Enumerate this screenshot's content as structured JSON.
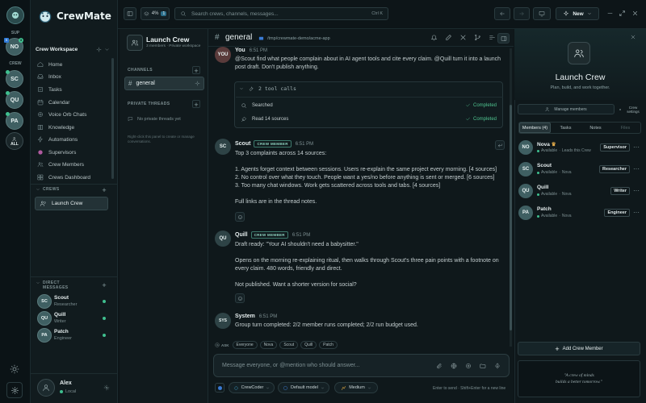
{
  "rail": {
    "sup_label": "SUP",
    "sup_avatar": "NO",
    "sup_badge": "5",
    "crew_label": "CREW",
    "crew_avatars": [
      "SC",
      "QU",
      "PA"
    ],
    "all_label": "ALL",
    "badge_a": "S",
    "badge_b": "3"
  },
  "brand": {
    "name": "CrewMate"
  },
  "sidebar": {
    "workspace": "Crew Workspace",
    "nav": [
      {
        "label": "Home",
        "icon": "home-icon"
      },
      {
        "label": "Inbox",
        "icon": "inbox-icon"
      },
      {
        "label": "Tasks",
        "icon": "tasks-icon"
      },
      {
        "label": "Calendar",
        "icon": "calendar-icon"
      },
      {
        "label": "Voice Orb Chats",
        "icon": "voice-icon"
      },
      {
        "label": "Knowledge",
        "icon": "book-icon"
      },
      {
        "label": "Automations",
        "icon": "automation-icon"
      },
      {
        "label": "Supervisors",
        "icon": "supervisor-icon"
      },
      {
        "label": "Crew Members",
        "icon": "members-icon"
      },
      {
        "label": "Crews Dashboard",
        "icon": "dashboard-icon"
      }
    ],
    "crews_header": "CREWS",
    "crew_item": "Launch Crew",
    "dm_header": "DIRECT MESSAGES",
    "dms": [
      {
        "name": "Scout",
        "role": "Researcher",
        "avatar": "SC"
      },
      {
        "name": "Quill",
        "role": "Writer",
        "avatar": "QU"
      },
      {
        "name": "Patch",
        "role": "Engineer",
        "avatar": "PA"
      }
    ],
    "user": {
      "name": "Alex",
      "status": "Local"
    }
  },
  "channel_panel": {
    "crew_name": "Launch Crew",
    "crew_meta": "3 members · Private workspace",
    "channels_header": "CHANNELS",
    "channel": "general",
    "private_header": "PRIVATE THREADS",
    "no_threads": "No private threads yet",
    "hint": "Right-click this panel to create or manage conversations."
  },
  "topbar": {
    "usage": "4%",
    "usage_count": "1",
    "search_placeholder": "Search crews, channels, messages...",
    "search_shortcut": "Ctrl K",
    "new_label": "New"
  },
  "channel_header": {
    "name": "general",
    "path": "/tmp/crewmate-demo/acme-app"
  },
  "messages": {
    "m1": {
      "avatar": "YOU",
      "name": "You",
      "time": "6:51 PM",
      "text": "@Scout find what people complain about in AI agent tools and cite every claim. @Quill turn it into a launch post draft. Don't publish anything."
    },
    "tool": {
      "title": "2 tool calls",
      "rows": [
        {
          "label": "Searched",
          "status": "Completed"
        },
        {
          "label": "Read 14 sources",
          "status": "Completed"
        }
      ]
    },
    "m2": {
      "avatar": "SC",
      "name": "Scout",
      "badge": "CREW MEMBER",
      "time": "6:51 PM",
      "lines": [
        "Top 3 complaints across 14 sources:",
        "",
        "1. Agents forget context between sessions. Users re-explain the same project every morning. [4 sources]",
        "2. No control over what they touch. People want a yes/no before anything is sent or merged. [6 sources]",
        "3. Too many chat windows. Work gets scattered across tools and tabs. [4 sources]",
        "",
        "Full links are in the thread notes."
      ]
    },
    "m3": {
      "avatar": "QU",
      "name": "Quill",
      "badge": "CREW MEMBER",
      "time": "6:51 PM",
      "lines": [
        "Draft ready: \"Your AI shouldn't need a babysitter.\"",
        "",
        "Opens on the morning re-explaining ritual, then walks through Scout's three pain points with a footnote on every claim. 480 words, friendly and direct.",
        "",
        "Not published. Want a shorter version for social?"
      ]
    },
    "m4": {
      "avatar": "SYS",
      "name": "System",
      "time": "6:51 PM",
      "text": "Group turn completed: 2/2 member runs completed; 2/2 run budget used."
    }
  },
  "ask": {
    "label": "ASK",
    "chips": [
      "Everyone",
      "Nova",
      "Scout",
      "Quill",
      "Patch"
    ]
  },
  "composer": {
    "placeholder": "Message everyone, or @mention who should answer...",
    "provider": "CrewCoder",
    "model": "Default model",
    "effort": "Medium",
    "hint": "Enter to send · Shift+Enter for a new line"
  },
  "right_panel": {
    "title": "Launch Crew",
    "subtitle": "Plan, build, and work together.",
    "manage_label": "Manage members",
    "settings_label": "Crew settings",
    "tabs": [
      "Members (4)",
      "Tasks",
      "Notes",
      "Files"
    ],
    "members": [
      {
        "avatar": "NO",
        "name": "Nova",
        "status": "Available",
        "extra": "Leads this Crew",
        "role": "Supervisor"
      },
      {
        "avatar": "SC",
        "name": "Scout",
        "status": "Available",
        "extra": "Nova",
        "role": "Researcher"
      },
      {
        "avatar": "QU",
        "name": "Quill",
        "status": "Available",
        "extra": "Nova",
        "role": "Writer"
      },
      {
        "avatar": "PA",
        "name": "Patch",
        "status": "Available",
        "extra": "Nova",
        "role": "Engineer"
      }
    ],
    "add_label": "Add Crew Member",
    "quote_lines": [
      "\"A crew of minds",
      "builds a better tomorrow.\""
    ]
  },
  "colors": {
    "accent": "#3fbf8f",
    "bg": "#0d1518",
    "panel": "#111b1e"
  }
}
